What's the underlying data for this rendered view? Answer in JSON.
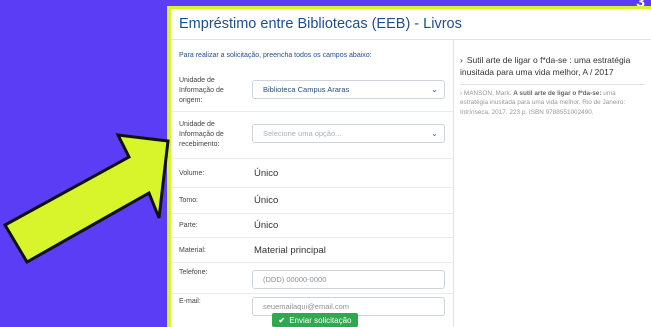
{
  "corner_number": "3",
  "header": {
    "title": "Empréstimo entre Bibliotecas (EEB) - Livros"
  },
  "form": {
    "instruction": "Para realizar a solicitação, preencha todos os campos abaixo:",
    "origin": {
      "label": "Unidade de Informação de origem:",
      "value": "Biblioteca Campus Araras"
    },
    "receiving": {
      "label": "Unidade de Informação de recebimento:",
      "placeholder": "Selecione uma opção..."
    },
    "volume": {
      "label": "Volume:",
      "value": "Único"
    },
    "tomo": {
      "label": "Tomo:",
      "value": "Único"
    },
    "parte": {
      "label": "Parte:",
      "value": "Único"
    },
    "material": {
      "label": "Material:",
      "value": "Material principal"
    },
    "telefone": {
      "label": "Telefone:",
      "placeholder": "(DDD) 00000-0000"
    },
    "email": {
      "label": "E-mail:",
      "placeholder": "seuemailaqui@email.com"
    },
    "submit_label": "Enviar solicitação"
  },
  "side": {
    "title": "Sutil arte de ligar o f*da-se : uma estratégia inusitada para uma vida melhor, A / 2017",
    "ref_prefix": "MANSON, Mark. ",
    "ref_bold": "A sutil arte de ligar o f*da-se:",
    "ref_rest": " uma estratégia inusitada para uma vida melhor. Rio de Janeiro: Intrínseca, 2017. 223 p. ISBN 9788551002490."
  },
  "colors": {
    "background": "#5b3df5",
    "accent": "#d7f52a",
    "button": "#2fa84f",
    "title": "#1f4e8a"
  },
  "icons": {
    "pointer": "arrow-icon",
    "submit": "check-icon",
    "select": "chevron-down-icon",
    "bullet": "chevron-right-icon"
  }
}
